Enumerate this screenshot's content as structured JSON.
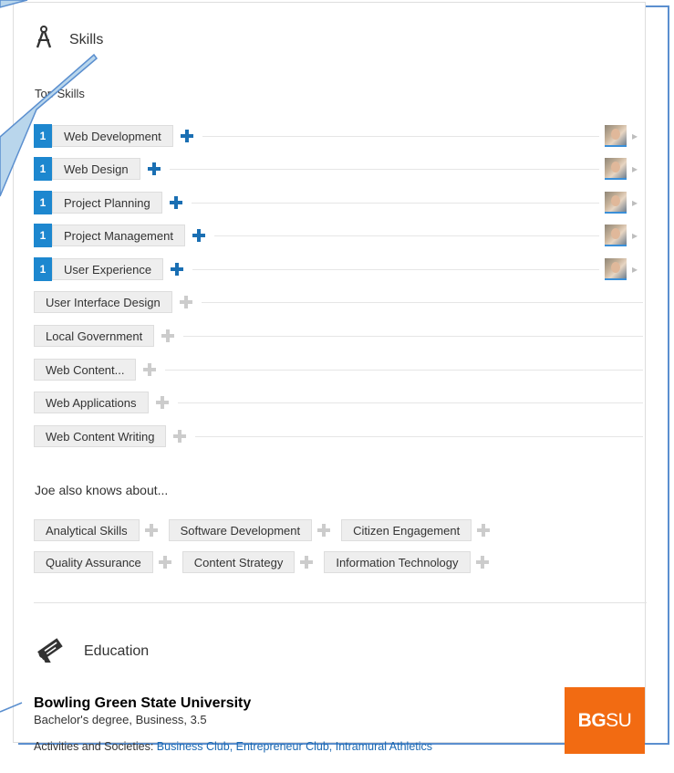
{
  "skills": {
    "title": "Skills",
    "top_label": "Top Skills",
    "items": [
      {
        "rank": "1",
        "name": "Web Development",
        "endorsed": true
      },
      {
        "rank": "1",
        "name": "Web Design",
        "endorsed": true
      },
      {
        "rank": "1",
        "name": "Project Planning",
        "endorsed": true
      },
      {
        "rank": "1",
        "name": "Project Management",
        "endorsed": true
      },
      {
        "rank": "1",
        "name": "User Experience",
        "endorsed": true
      },
      {
        "rank": "",
        "name": "User Interface Design",
        "endorsed": false
      },
      {
        "rank": "",
        "name": "Local Government",
        "endorsed": false
      },
      {
        "rank": "",
        "name": "Web Content...",
        "endorsed": false
      },
      {
        "rank": "",
        "name": "Web Applications",
        "endorsed": false
      },
      {
        "rank": "",
        "name": "Web Content Writing",
        "endorsed": false
      }
    ],
    "also_label": "Joe also knows about...",
    "also": [
      [
        "Analytical Skills",
        "Software Development",
        "Citizen Engagement"
      ],
      [
        "Quality Assurance",
        "Content Strategy",
        "Information Technology"
      ]
    ]
  },
  "education": {
    "title": "Education",
    "school": "Bowling Green State University",
    "degree": "Bachelor's degree, Business, 3.5",
    "activities_label": "Activities and Societies:",
    "activities": "Business Club, Entrepreneur Club, Intramural Athletics",
    "logo_bold": "BG",
    "logo_light": "SU"
  },
  "colors": {
    "accent": "#1d87cf",
    "plus_active": "#1a6fb3",
    "plus_inactive": "#cccccc",
    "callout": "#5b8fcf",
    "logo": "#f26b12"
  },
  "icons": {
    "skills": "compass-icon",
    "education": "diploma-icon",
    "plus": "plus-icon",
    "chevron": "chevron-right-icon"
  }
}
